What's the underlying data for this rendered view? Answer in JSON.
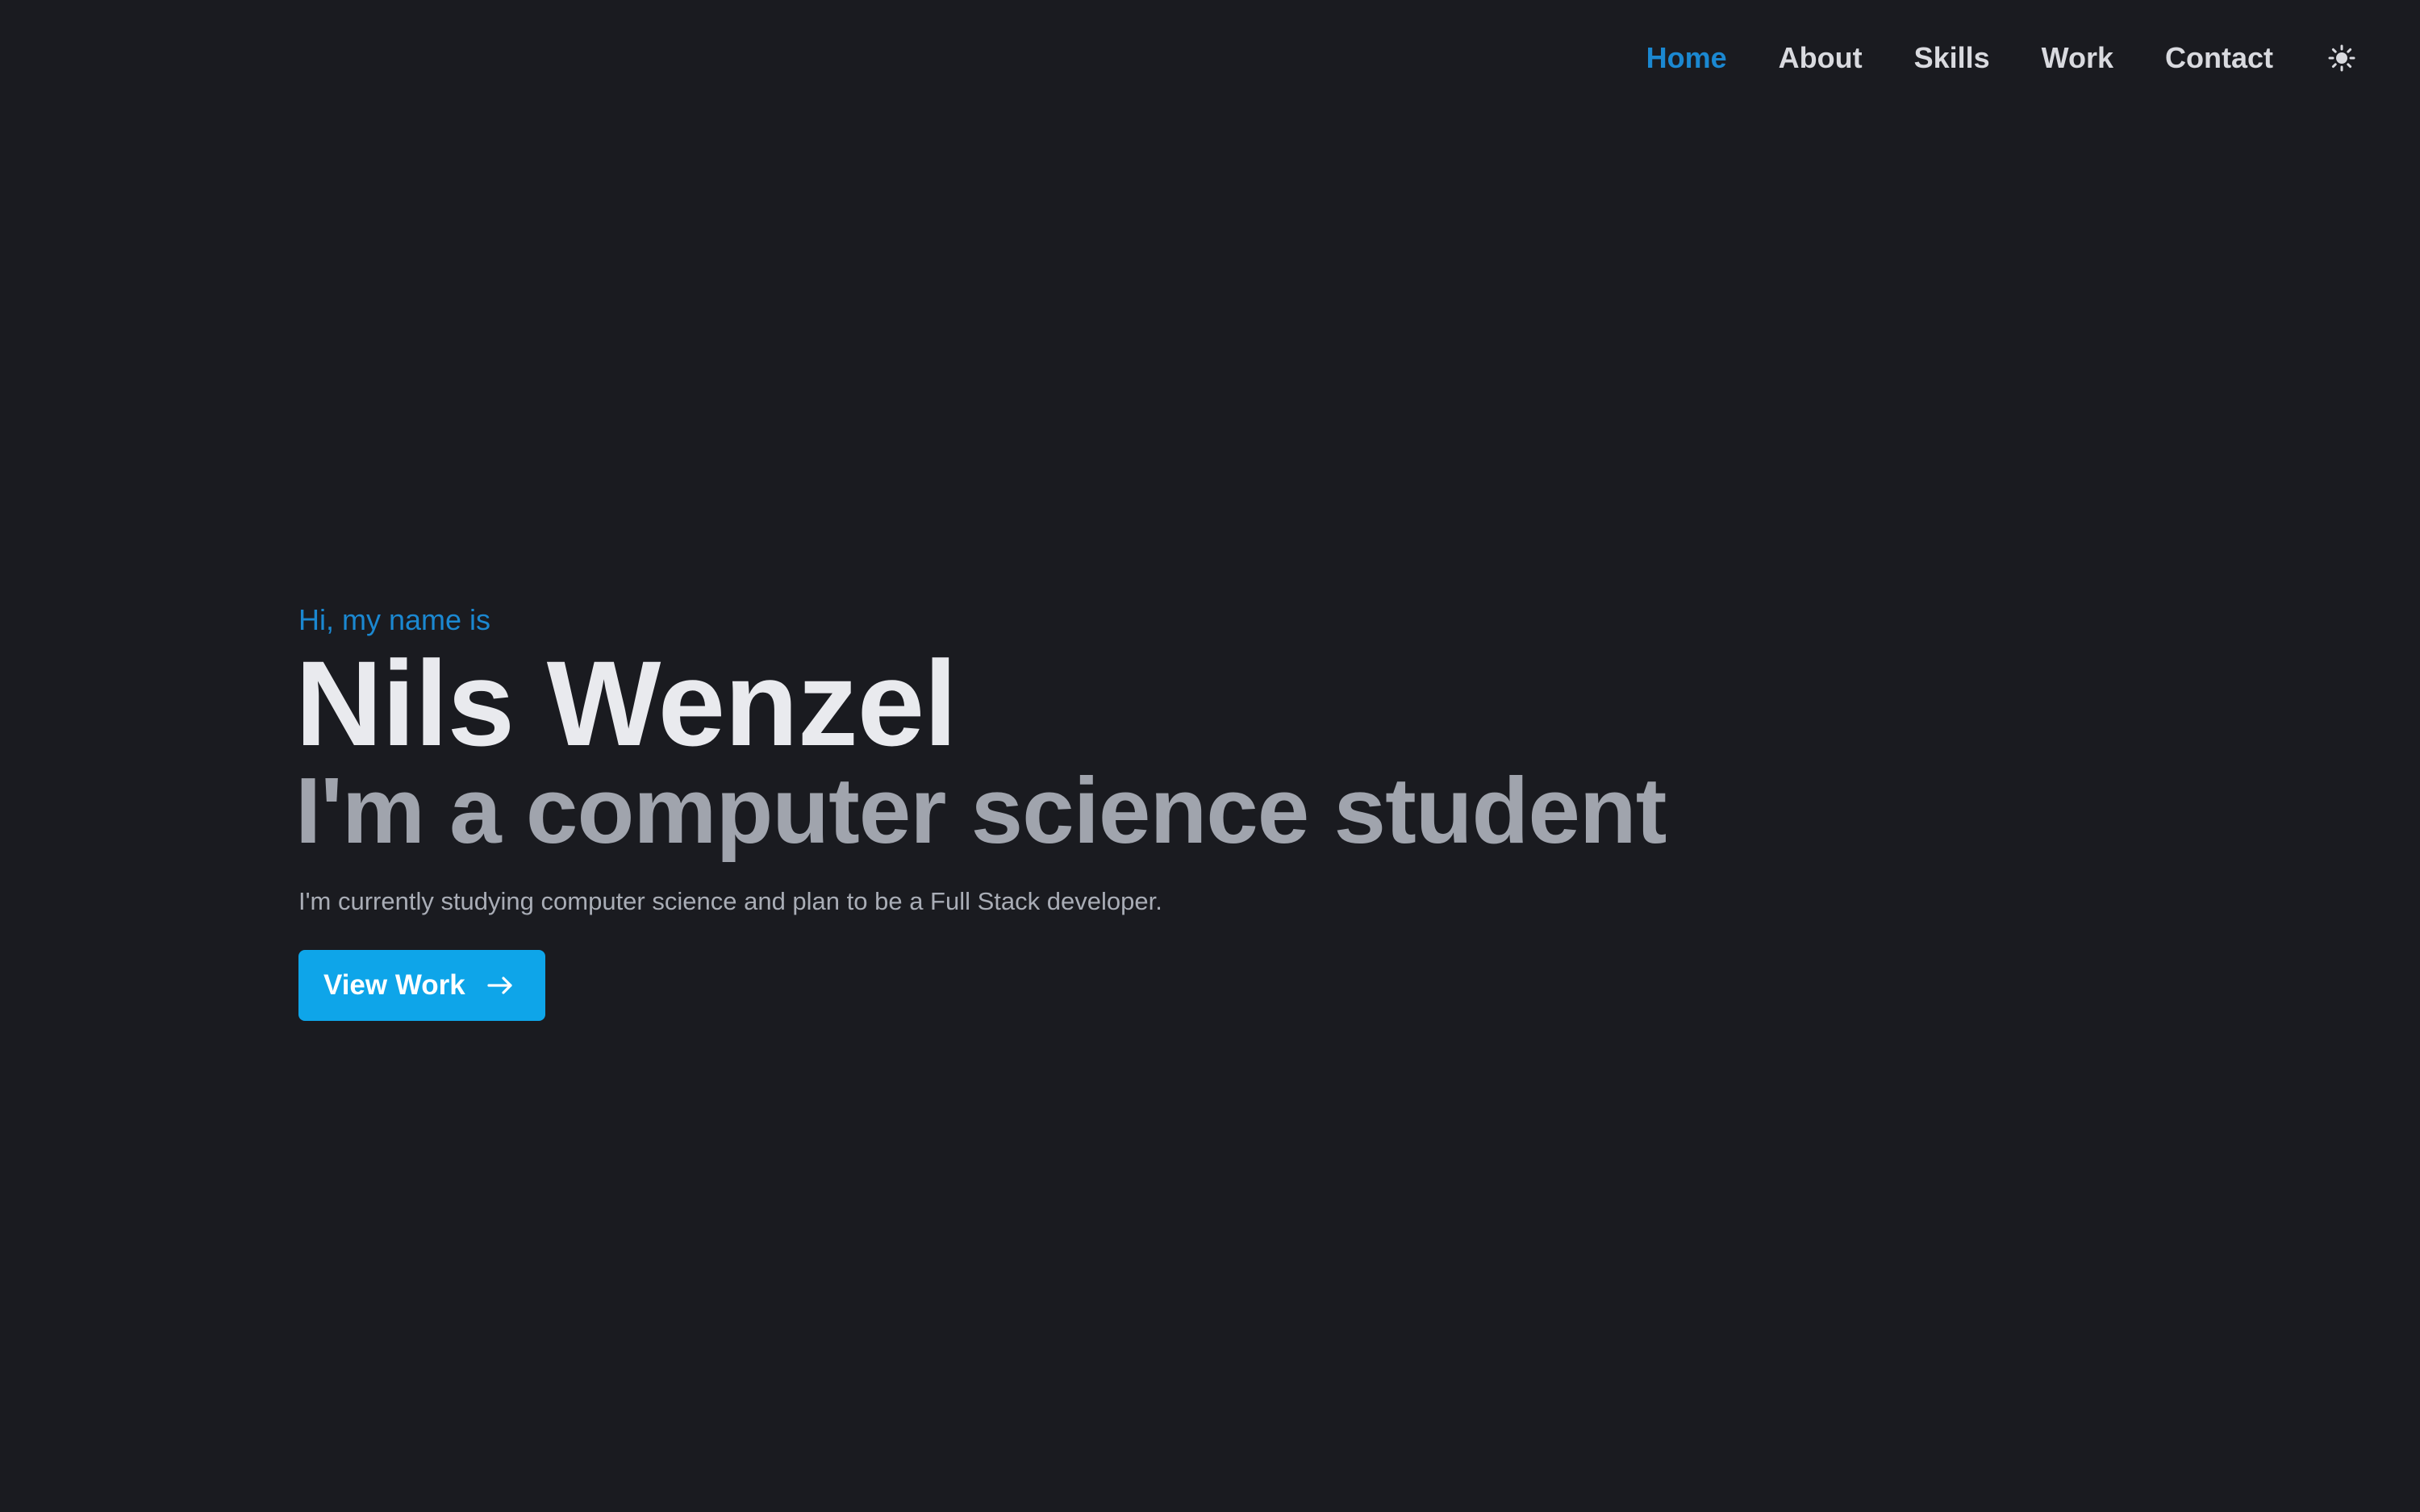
{
  "nav": {
    "items": [
      {
        "label": "Home",
        "active": true
      },
      {
        "label": "About",
        "active": false
      },
      {
        "label": "Skills",
        "active": false
      },
      {
        "label": "Work",
        "active": false
      },
      {
        "label": "Contact",
        "active": false
      }
    ],
    "theme_toggle_icon": "sun-icon"
  },
  "hero": {
    "greeting": "Hi, my name is",
    "name": "Nils Wenzel",
    "headline": "I'm a computer science student",
    "description": "I'm currently studying computer science and plan to be a Full Stack developer.",
    "cta": {
      "label": "View Work",
      "icon": "arrow-right-icon"
    }
  },
  "colors": {
    "background": "#1a1b20",
    "accent": "#1b88d1",
    "button": "#0ea5e9",
    "name_text": "#e9eaee",
    "headline_text": "#a0a4ad",
    "body_text": "#a9adb6",
    "nav_text": "#d9dadf"
  }
}
